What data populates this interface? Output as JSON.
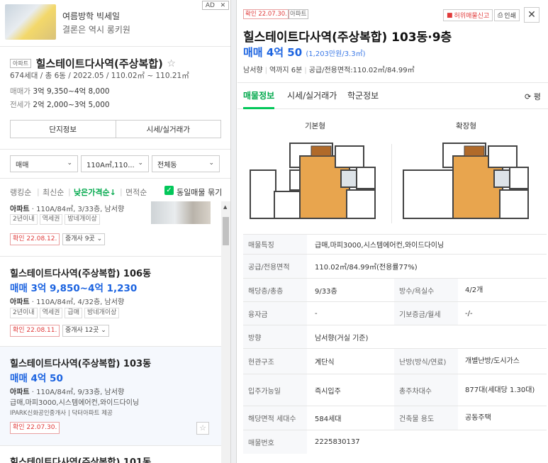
{
  "ad": {
    "title": "여름방학 빅세일",
    "subtitle": "결론은 역시 롱키원",
    "badge": "AD",
    "close": "✕"
  },
  "complex": {
    "type_chip": "아파트",
    "name": "힐스테이트다사역(주상복합)",
    "star": "☆",
    "meta": "674세대 / 총 6동 / 2022.05 / 110.02㎡ ~ 110.21㎡",
    "sale_label": "매매가",
    "sale_value": "3억 9,350~4억 8,000",
    "lease_label": "전세가",
    "lease_value": "2억 2,000~3억 5,000",
    "tab_info": "단지정보",
    "tab_price": "시세/실거래가"
  },
  "filters": {
    "trade": "매매",
    "area": "110A㎡,110...",
    "dong": "전체동",
    "chevron": "⌄"
  },
  "sort": {
    "ranking": "랭킹순",
    "latest": "최신순",
    "low_price": "낮은가격순↓",
    "area": "면적순",
    "check": "✓",
    "group_label": "동일매물 묶기"
  },
  "listings": [
    {
      "desc_type": "아파트",
      "desc_rest": " · 110A/84㎡, 3/33층, 남서향",
      "tags": [
        "2년이내",
        "역세권",
        "방네개이상"
      ],
      "verified": "확인 22.08.12.",
      "brokers": "중개사 9곳 ⌄"
    },
    {
      "title": "힐스테이트다사역(주상복합) 106동",
      "price": "매매 3억 9,850~4억 1,230",
      "desc_type": "아파트",
      "desc_rest": " · 110A/84㎡, 4/32층, 남서향",
      "tags": [
        "2년이내",
        "역세권",
        "급매",
        "방네개이상"
      ],
      "verified": "확인 22.08.11.",
      "brokers": "중개사 12곳 ⌄"
    },
    {
      "title": "힐스테이트다사역(주상복합) 103동",
      "price": "매매 4억 50",
      "desc_type": "아파트",
      "desc_rest": " · 110A/84㎡, 9/33층, 남서향",
      "desc2": "급매,마피3000,시스템에어컨,와이드다이닝",
      "agency": "IPARK신화공인중개사 | 닥터아파트 제공",
      "verified": "확인 22.07.30.",
      "fav": "☆"
    },
    {
      "title": "힐스테이트다사역(주상복합) 101동"
    }
  ],
  "detail": {
    "verified": "확인 22.07.30.",
    "type_chip": "아파트",
    "report": "허위매물신고",
    "print": "인쇄",
    "close": "✕",
    "title": "힐스테이트다사역(주상복합) 103동·9층",
    "price": "매매 4억 50",
    "price_sub": "(1,203만원/3.3㎡)",
    "info1": "남서향",
    "info2": "역까지 6분",
    "info3": "공급/전용면적:110.02㎡/84.99㎡",
    "tabs": [
      "매물정보",
      "시세/실거래가",
      "학군정보"
    ],
    "refresh": "⟳ 평",
    "plan_basic": "기본형",
    "plan_ext": "확장형"
  },
  "specs": [
    {
      "k": "매물특징",
      "v": "급매,마피3000,시스템에어컨,와이드다이닝"
    },
    {
      "k": "공급/전용면적",
      "v": "110.02㎡/84.99㎡(전용률77%)"
    },
    {
      "k": "해당층/총층",
      "v": "9/33층",
      "k2": "방수/욕실수",
      "v2": "4/2개"
    },
    {
      "k": "융자금",
      "v": "-",
      "k2": "기보증금/월세",
      "v2": "-/-"
    },
    {
      "k": "방향",
      "v": "남서향(거실 기준)"
    },
    {
      "k": "현관구조",
      "v": "계단식",
      "k2": "난방(방식/연료)",
      "v2": "개별난방/도시가스"
    },
    {
      "k": "입주가능일",
      "v": "즉시입주",
      "k2": "총주차대수",
      "v2": "877대(세대당 1.30대)"
    },
    {
      "k": "해당면적 세대수",
      "v": "584세대",
      "k2": "건축물 용도",
      "v2": "공동주택"
    },
    {
      "k": "매물번호",
      "v": "2225830137"
    }
  ]
}
